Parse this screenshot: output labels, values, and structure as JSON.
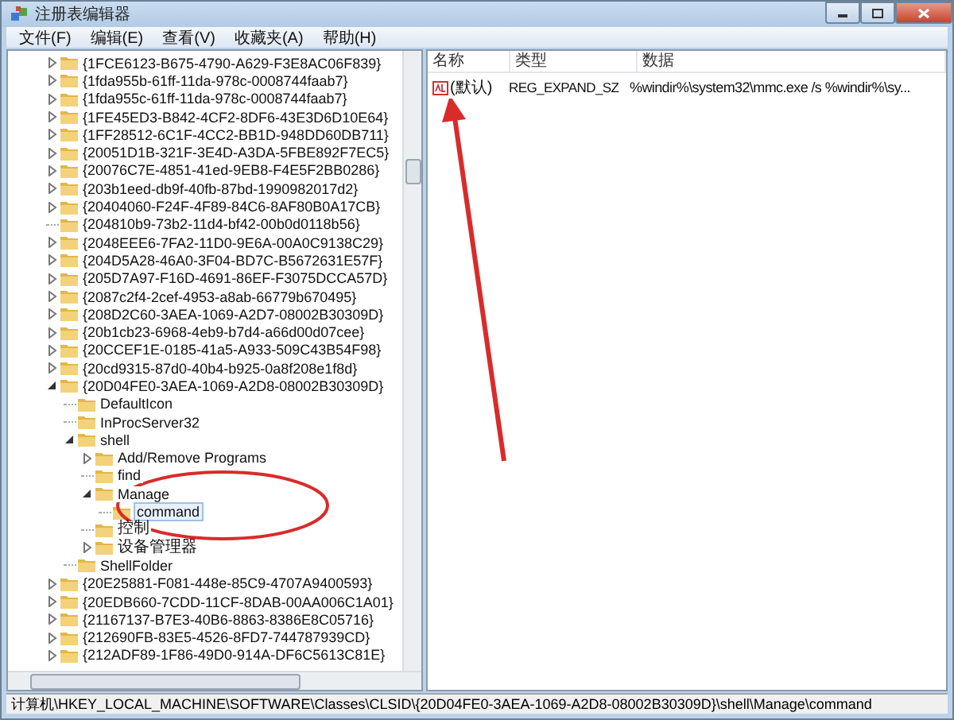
{
  "window": {
    "title": "注册表编辑器"
  },
  "menu": [
    "文件(F)",
    "编辑(E)",
    "查看(V)",
    "收藏夹(A)",
    "帮助(H)"
  ],
  "tree": [
    {
      "label": "{1FCE6123-B675-4790-A629-F3E8AC06F839}",
      "kind": "collapsed",
      "selected": false
    },
    {
      "label": "{1fda955b-61ff-11da-978c-0008744faab7}",
      "kind": "collapsed",
      "selected": false
    },
    {
      "label": "{1fda955c-61ff-11da-978c-0008744faab7}",
      "kind": "collapsed",
      "selected": false
    },
    {
      "label": "{1FE45ED3-B842-4CF2-8DF6-43E3D6D10E64}",
      "kind": "collapsed",
      "selected": false
    },
    {
      "label": "{1FF28512-6C1F-4CC2-BB1D-948DD60DB711}",
      "kind": "collapsed",
      "selected": false
    },
    {
      "label": "{20051D1B-321F-3E4D-A3DA-5FBE892F7EC5}",
      "kind": "collapsed",
      "selected": false
    },
    {
      "label": "{20076C7E-4851-41ed-9EB8-F4E5F2BB0286}",
      "kind": "collapsed",
      "selected": false
    },
    {
      "label": "{203b1eed-db9f-40fb-87bd-1990982017d2}",
      "kind": "collapsed",
      "selected": false
    },
    {
      "label": "{20404060-F24F-4F89-84C6-8AF80B0A17CB}",
      "kind": "collapsed",
      "selected": false
    },
    {
      "label": "{204810b9-73b2-11d4-bf42-00b0d0118b56}",
      "kind": "leaf",
      "selected": false
    },
    {
      "label": "{2048EEE6-7FA2-11D0-9E6A-00A0C9138C29}",
      "kind": "collapsed",
      "selected": false
    },
    {
      "label": "{204D5A28-46A0-3F04-BD7C-B5672631E57F}",
      "kind": "collapsed",
      "selected": false
    },
    {
      "label": "{205D7A97-F16D-4691-86EF-F3075DCCA57D}",
      "kind": "collapsed",
      "selected": false
    },
    {
      "label": "{2087c2f4-2cef-4953-a8ab-66779b670495}",
      "kind": "collapsed",
      "selected": false
    },
    {
      "label": "{208D2C60-3AEA-1069-A2D7-08002B30309D}",
      "kind": "collapsed",
      "selected": false
    },
    {
      "label": "{20b1cb23-6968-4eb9-b7d4-a66d00d07cee}",
      "kind": "collapsed",
      "selected": false
    },
    {
      "label": "{20CCEF1E-0185-41a5-A933-509C43B54F98}",
      "kind": "collapsed",
      "selected": false
    },
    {
      "label": "{20cd9315-87d0-40b4-b925-0a8f208e1f8d}",
      "kind": "collapsed",
      "selected": false
    },
    {
      "label": "{20D04FE0-3AEA-1069-A2D8-08002B30309D}",
      "kind": "expanded",
      "selected": false,
      "children": [
        {
          "label": "DefaultIcon",
          "kind": "leaf",
          "selected": false
        },
        {
          "label": "InProcServer32",
          "kind": "leaf",
          "selected": false
        },
        {
          "label": "shell",
          "kind": "expanded",
          "selected": false,
          "children": [
            {
              "label": "Add/Remove Programs",
              "kind": "collapsed",
              "selected": false
            },
            {
              "label": "find",
              "kind": "leaf",
              "selected": false
            },
            {
              "label": "Manage",
              "kind": "expanded",
              "selected": false,
              "children": [
                {
                  "label": "command",
                  "kind": "leaf",
                  "selected": true
                }
              ]
            },
            {
              "label": "控制",
              "kind": "leaf",
              "selected": false
            },
            {
              "label": "设备管理器",
              "kind": "collapsed",
              "selected": false
            }
          ]
        },
        {
          "label": "ShellFolder",
          "kind": "leaf",
          "selected": false
        }
      ]
    },
    {
      "label": "{20E25881-F081-448e-85C9-4707A9400593}",
      "kind": "collapsed",
      "selected": false
    },
    {
      "label": "{20EDB660-7CDD-11CF-8DAB-00AA006C1A01}",
      "kind": "collapsed",
      "selected": false
    },
    {
      "label": "{21167137-B7E3-40B6-8863-8386E8C05716}",
      "kind": "collapsed",
      "selected": false
    },
    {
      "label": "{212690FB-83E5-4526-8FD7-744787939CD}",
      "kind": "collapsed",
      "selected": false
    },
    {
      "label": "{212ADF89-1F86-49D0-914A-DF6C5613C81E}",
      "kind": "collapsed",
      "selected": false
    }
  ],
  "table": {
    "columns": [
      "名称",
      "类型",
      "数据"
    ],
    "rows": [
      {
        "name": "(默认)",
        "type": "REG_EXPAND_SZ",
        "data": "%windir%\\system32\\mmc.exe /s %windir%\\sy..."
      }
    ]
  },
  "status_bar": "计算机\\HKEY_LOCAL_MACHINE\\SOFTWARE\\Classes\\CLSID\\{20D04FE0-3AEA-1069-A2D8-08002B30309D}\\shell\\Manage\\command"
}
